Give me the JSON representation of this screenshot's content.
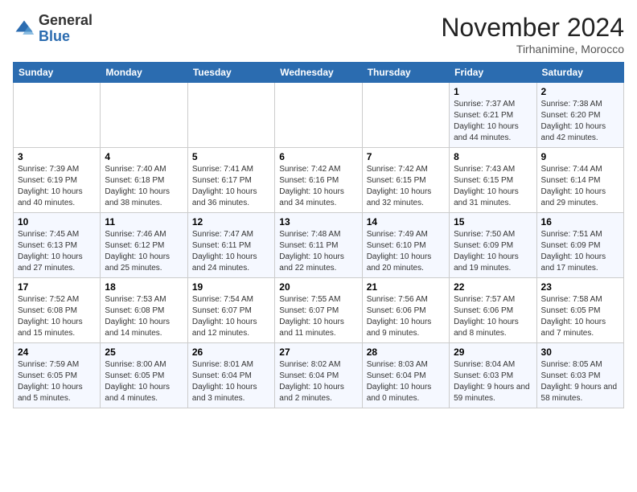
{
  "header": {
    "logo_general": "General",
    "logo_blue": "Blue",
    "month_title": "November 2024",
    "location": "Tirhanimine, Morocco"
  },
  "weekdays": [
    "Sunday",
    "Monday",
    "Tuesday",
    "Wednesday",
    "Thursday",
    "Friday",
    "Saturday"
  ],
  "weeks": [
    [
      {
        "day": "",
        "info": ""
      },
      {
        "day": "",
        "info": ""
      },
      {
        "day": "",
        "info": ""
      },
      {
        "day": "",
        "info": ""
      },
      {
        "day": "",
        "info": ""
      },
      {
        "day": "1",
        "info": "Sunrise: 7:37 AM\nSunset: 6:21 PM\nDaylight: 10 hours and 44 minutes."
      },
      {
        "day": "2",
        "info": "Sunrise: 7:38 AM\nSunset: 6:20 PM\nDaylight: 10 hours and 42 minutes."
      }
    ],
    [
      {
        "day": "3",
        "info": "Sunrise: 7:39 AM\nSunset: 6:19 PM\nDaylight: 10 hours and 40 minutes."
      },
      {
        "day": "4",
        "info": "Sunrise: 7:40 AM\nSunset: 6:18 PM\nDaylight: 10 hours and 38 minutes."
      },
      {
        "day": "5",
        "info": "Sunrise: 7:41 AM\nSunset: 6:17 PM\nDaylight: 10 hours and 36 minutes."
      },
      {
        "day": "6",
        "info": "Sunrise: 7:42 AM\nSunset: 6:16 PM\nDaylight: 10 hours and 34 minutes."
      },
      {
        "day": "7",
        "info": "Sunrise: 7:42 AM\nSunset: 6:15 PM\nDaylight: 10 hours and 32 minutes."
      },
      {
        "day": "8",
        "info": "Sunrise: 7:43 AM\nSunset: 6:15 PM\nDaylight: 10 hours and 31 minutes."
      },
      {
        "day": "9",
        "info": "Sunrise: 7:44 AM\nSunset: 6:14 PM\nDaylight: 10 hours and 29 minutes."
      }
    ],
    [
      {
        "day": "10",
        "info": "Sunrise: 7:45 AM\nSunset: 6:13 PM\nDaylight: 10 hours and 27 minutes."
      },
      {
        "day": "11",
        "info": "Sunrise: 7:46 AM\nSunset: 6:12 PM\nDaylight: 10 hours and 25 minutes."
      },
      {
        "day": "12",
        "info": "Sunrise: 7:47 AM\nSunset: 6:11 PM\nDaylight: 10 hours and 24 minutes."
      },
      {
        "day": "13",
        "info": "Sunrise: 7:48 AM\nSunset: 6:11 PM\nDaylight: 10 hours and 22 minutes."
      },
      {
        "day": "14",
        "info": "Sunrise: 7:49 AM\nSunset: 6:10 PM\nDaylight: 10 hours and 20 minutes."
      },
      {
        "day": "15",
        "info": "Sunrise: 7:50 AM\nSunset: 6:09 PM\nDaylight: 10 hours and 19 minutes."
      },
      {
        "day": "16",
        "info": "Sunrise: 7:51 AM\nSunset: 6:09 PM\nDaylight: 10 hours and 17 minutes."
      }
    ],
    [
      {
        "day": "17",
        "info": "Sunrise: 7:52 AM\nSunset: 6:08 PM\nDaylight: 10 hours and 15 minutes."
      },
      {
        "day": "18",
        "info": "Sunrise: 7:53 AM\nSunset: 6:08 PM\nDaylight: 10 hours and 14 minutes."
      },
      {
        "day": "19",
        "info": "Sunrise: 7:54 AM\nSunset: 6:07 PM\nDaylight: 10 hours and 12 minutes."
      },
      {
        "day": "20",
        "info": "Sunrise: 7:55 AM\nSunset: 6:07 PM\nDaylight: 10 hours and 11 minutes."
      },
      {
        "day": "21",
        "info": "Sunrise: 7:56 AM\nSunset: 6:06 PM\nDaylight: 10 hours and 9 minutes."
      },
      {
        "day": "22",
        "info": "Sunrise: 7:57 AM\nSunset: 6:06 PM\nDaylight: 10 hours and 8 minutes."
      },
      {
        "day": "23",
        "info": "Sunrise: 7:58 AM\nSunset: 6:05 PM\nDaylight: 10 hours and 7 minutes."
      }
    ],
    [
      {
        "day": "24",
        "info": "Sunrise: 7:59 AM\nSunset: 6:05 PM\nDaylight: 10 hours and 5 minutes."
      },
      {
        "day": "25",
        "info": "Sunrise: 8:00 AM\nSunset: 6:05 PM\nDaylight: 10 hours and 4 minutes."
      },
      {
        "day": "26",
        "info": "Sunrise: 8:01 AM\nSunset: 6:04 PM\nDaylight: 10 hours and 3 minutes."
      },
      {
        "day": "27",
        "info": "Sunrise: 8:02 AM\nSunset: 6:04 PM\nDaylight: 10 hours and 2 minutes."
      },
      {
        "day": "28",
        "info": "Sunrise: 8:03 AM\nSunset: 6:04 PM\nDaylight: 10 hours and 0 minutes."
      },
      {
        "day": "29",
        "info": "Sunrise: 8:04 AM\nSunset: 6:03 PM\nDaylight: 9 hours and 59 minutes."
      },
      {
        "day": "30",
        "info": "Sunrise: 8:05 AM\nSunset: 6:03 PM\nDaylight: 9 hours and 58 minutes."
      }
    ]
  ]
}
